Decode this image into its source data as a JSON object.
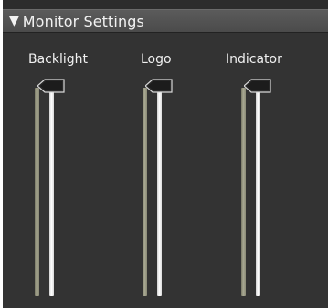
{
  "panel": {
    "title": "Monitor Settings",
    "expand_arrow": "▼"
  },
  "sliders": [
    {
      "label": "Backlight"
    },
    {
      "label": "Logo"
    },
    {
      "label": "Indicator"
    }
  ],
  "colors": {
    "panel_bg": "#333333",
    "header_bg": "#4f4f4f",
    "text": "#f0f0f0"
  }
}
